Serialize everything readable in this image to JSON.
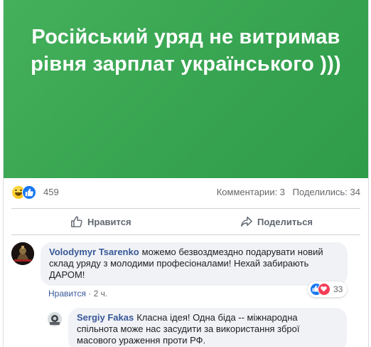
{
  "post": {
    "banner_text": "Російський уряд не витримав рівня зарплат українського )))",
    "banner_colors": [
      "#45b05b",
      "#2f9c4a"
    ],
    "reaction_count": "459",
    "comments_label": "Комментарии: 3",
    "shares_label": "Поделились: 34",
    "reaction_icons": [
      "haha-icon",
      "like-icon"
    ]
  },
  "actions": {
    "like_label": "Нравится",
    "share_label": "Поделиться"
  },
  "comments": [
    {
      "author": "Volodymyr Tsarenko",
      "text": "можемо безвоздмездно подарувати новий склад уряду з молодими професіоналами! Нехай забирають ДАРОМ!",
      "like_link": "Нравится",
      "separator": "·",
      "time": "2 ч.",
      "reaction_count": "33"
    },
    {
      "author": "Sergiy Fakas",
      "text": "Класна ідея! Одна біда -- міжнародна спільнота може нас засудити за використання зброї масового ураження проти РФ."
    }
  ]
}
